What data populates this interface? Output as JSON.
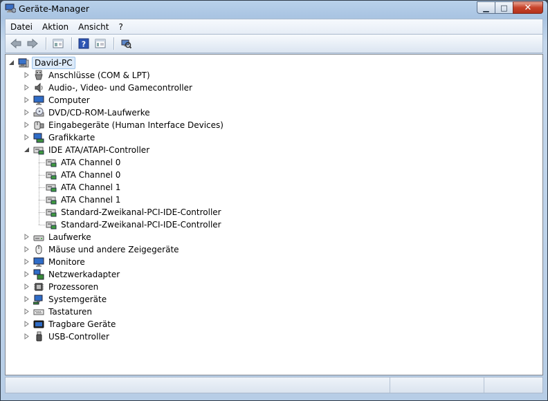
{
  "window": {
    "title": "Geräte-Manager",
    "app_icon": "device-manager-icon"
  },
  "caption_buttons": [
    {
      "name": "minimize-button",
      "glyph": "▁"
    },
    {
      "name": "maximize-button",
      "glyph": "□"
    },
    {
      "name": "close-button",
      "glyph": "✕"
    }
  ],
  "menu": {
    "items": [
      "Datei",
      "Aktion",
      "Ansicht",
      "?"
    ]
  },
  "toolbar": {
    "buttons": [
      "back-arrow-icon",
      "forward-arrow-icon",
      "show-hide-console-tree-icon",
      "help-icon",
      "properties-icon",
      "scan-hardware-icon"
    ]
  },
  "tree": {
    "root": {
      "label": "David-PC",
      "icon": "computer-icon",
      "expanded": true,
      "selected": true
    },
    "categories": [
      {
        "label": "Anschlüsse (COM & LPT)",
        "icon": "port-icon",
        "expanded": false
      },
      {
        "label": "Audio-, Video- und Gamecontroller",
        "icon": "speaker-icon",
        "expanded": false
      },
      {
        "label": "Computer",
        "icon": "monitor-icon",
        "expanded": false
      },
      {
        "label": "DVD/CD-ROM-Laufwerke",
        "icon": "optical-drive-icon",
        "expanded": false
      },
      {
        "label": "Eingabegeräte (Human Interface Devices)",
        "icon": "hid-icon",
        "expanded": false
      },
      {
        "label": "Grafikkarte",
        "icon": "display-adapter-icon",
        "expanded": false
      },
      {
        "label": "IDE ATA/ATAPI-Controller",
        "icon": "ide-controller-icon",
        "expanded": true,
        "children": [
          {
            "label": "ATA Channel 0",
            "icon": "ide-controller-icon"
          },
          {
            "label": "ATA Channel 0",
            "icon": "ide-controller-icon"
          },
          {
            "label": "ATA Channel 1",
            "icon": "ide-controller-icon"
          },
          {
            "label": "ATA Channel 1",
            "icon": "ide-controller-icon"
          },
          {
            "label": "Standard-Zweikanal-PCI-IDE-Controller",
            "icon": "ide-controller-icon"
          },
          {
            "label": "Standard-Zweikanal-PCI-IDE-Controller",
            "icon": "ide-controller-icon"
          }
        ]
      },
      {
        "label": "Laufwerke",
        "icon": "disk-drive-icon",
        "expanded": false
      },
      {
        "label": "Mäuse und andere Zeigegeräte",
        "icon": "mouse-icon",
        "expanded": false
      },
      {
        "label": "Monitore",
        "icon": "monitor-icon",
        "expanded": false
      },
      {
        "label": "Netzwerkadapter",
        "icon": "network-adapter-icon",
        "expanded": false
      },
      {
        "label": "Prozessoren",
        "icon": "processor-icon",
        "expanded": false
      },
      {
        "label": "Systemgeräte",
        "icon": "system-device-icon",
        "expanded": false
      },
      {
        "label": "Tastaturen",
        "icon": "keyboard-icon",
        "expanded": false
      },
      {
        "label": "Tragbare Geräte",
        "icon": "portable-device-icon",
        "expanded": false
      },
      {
        "label": "USB-Controller",
        "icon": "usb-icon",
        "expanded": false
      }
    ]
  },
  "statusbar": {
    "panels": [
      "",
      "",
      ""
    ]
  },
  "colors": {
    "selection": "#dceaf9",
    "selection_border": "#9cc3ea",
    "frame": "#b9d1ea"
  }
}
